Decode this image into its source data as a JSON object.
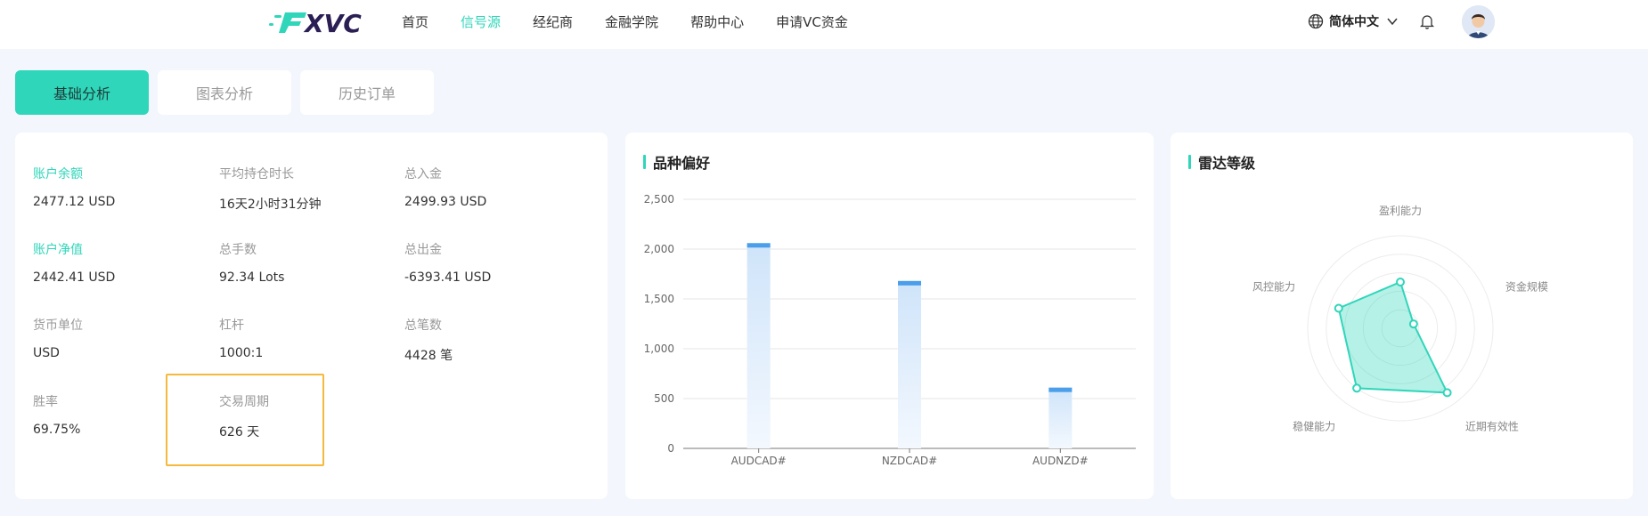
{
  "header": {
    "logo_text": "XVC",
    "nav": [
      {
        "label": "首页",
        "active": false
      },
      {
        "label": "信号源",
        "active": true
      },
      {
        "label": "经纪商",
        "active": false
      },
      {
        "label": "金融学院",
        "active": false
      },
      {
        "label": "帮助中心",
        "active": false
      },
      {
        "label": "申请VC资金",
        "active": false
      }
    ],
    "language": "简体中文",
    "icons": [
      "globe-icon",
      "chevron-down-icon",
      "bell-icon",
      "avatar"
    ]
  },
  "tabs": [
    {
      "label": "基础分析",
      "active": true
    },
    {
      "label": "图表分析",
      "active": false
    },
    {
      "label": "历史订单",
      "active": false
    }
  ],
  "stats": {
    "balance": {
      "label": "账户余额",
      "value": "2477.12 USD"
    },
    "avg_hold": {
      "label": "平均持仓时长",
      "value": "16天2小时31分钟"
    },
    "total_deposit": {
      "label": "总入金",
      "value": "2499.93 USD"
    },
    "equity": {
      "label": "账户净值",
      "value": "2442.41 USD"
    },
    "total_lots": {
      "label": "总手数",
      "value": "92.34 Lots"
    },
    "total_withdraw": {
      "label": "总出金",
      "value": "-6393.41 USD"
    },
    "currency": {
      "label": "货币单位",
      "value": "USD"
    },
    "leverage": {
      "label": "杠杆",
      "value": "1000:1"
    },
    "total_trades": {
      "label": "总笔数",
      "value": "4428 笔"
    },
    "win_rate": {
      "label": "胜率",
      "value": "69.75%"
    },
    "trade_period": {
      "label": "交易周期",
      "value": "626 天"
    }
  },
  "colors": {
    "accent": "#2fd6ba",
    "highlight": "#f6b93b",
    "bar": "#4a9eea"
  },
  "bar_card": {
    "title": "品种偏好",
    "chart_data": {
      "type": "bar",
      "categories": [
        "AUDCAD#",
        "NZDCAD#",
        "AUDNZD#"
      ],
      "values": [
        2060,
        1680,
        610
      ],
      "ylim": [
        0,
        2500
      ],
      "yticks": [
        "0",
        "500",
        "1,000",
        "1,500",
        "2,000",
        "2,500"
      ],
      "ytick_values": [
        0,
        500,
        1000,
        1500,
        2000,
        2500
      ],
      "grid": true
    }
  },
  "radar_card": {
    "title": "雷达等级",
    "chart_data": {
      "type": "radar",
      "indicators": [
        "盈利能力",
        "资金规模",
        "近期有效性",
        "稳健能力",
        "风控能力"
      ],
      "values": [
        0.5,
        0.15,
        0.86,
        0.8,
        0.7
      ],
      "max": 1
    }
  }
}
